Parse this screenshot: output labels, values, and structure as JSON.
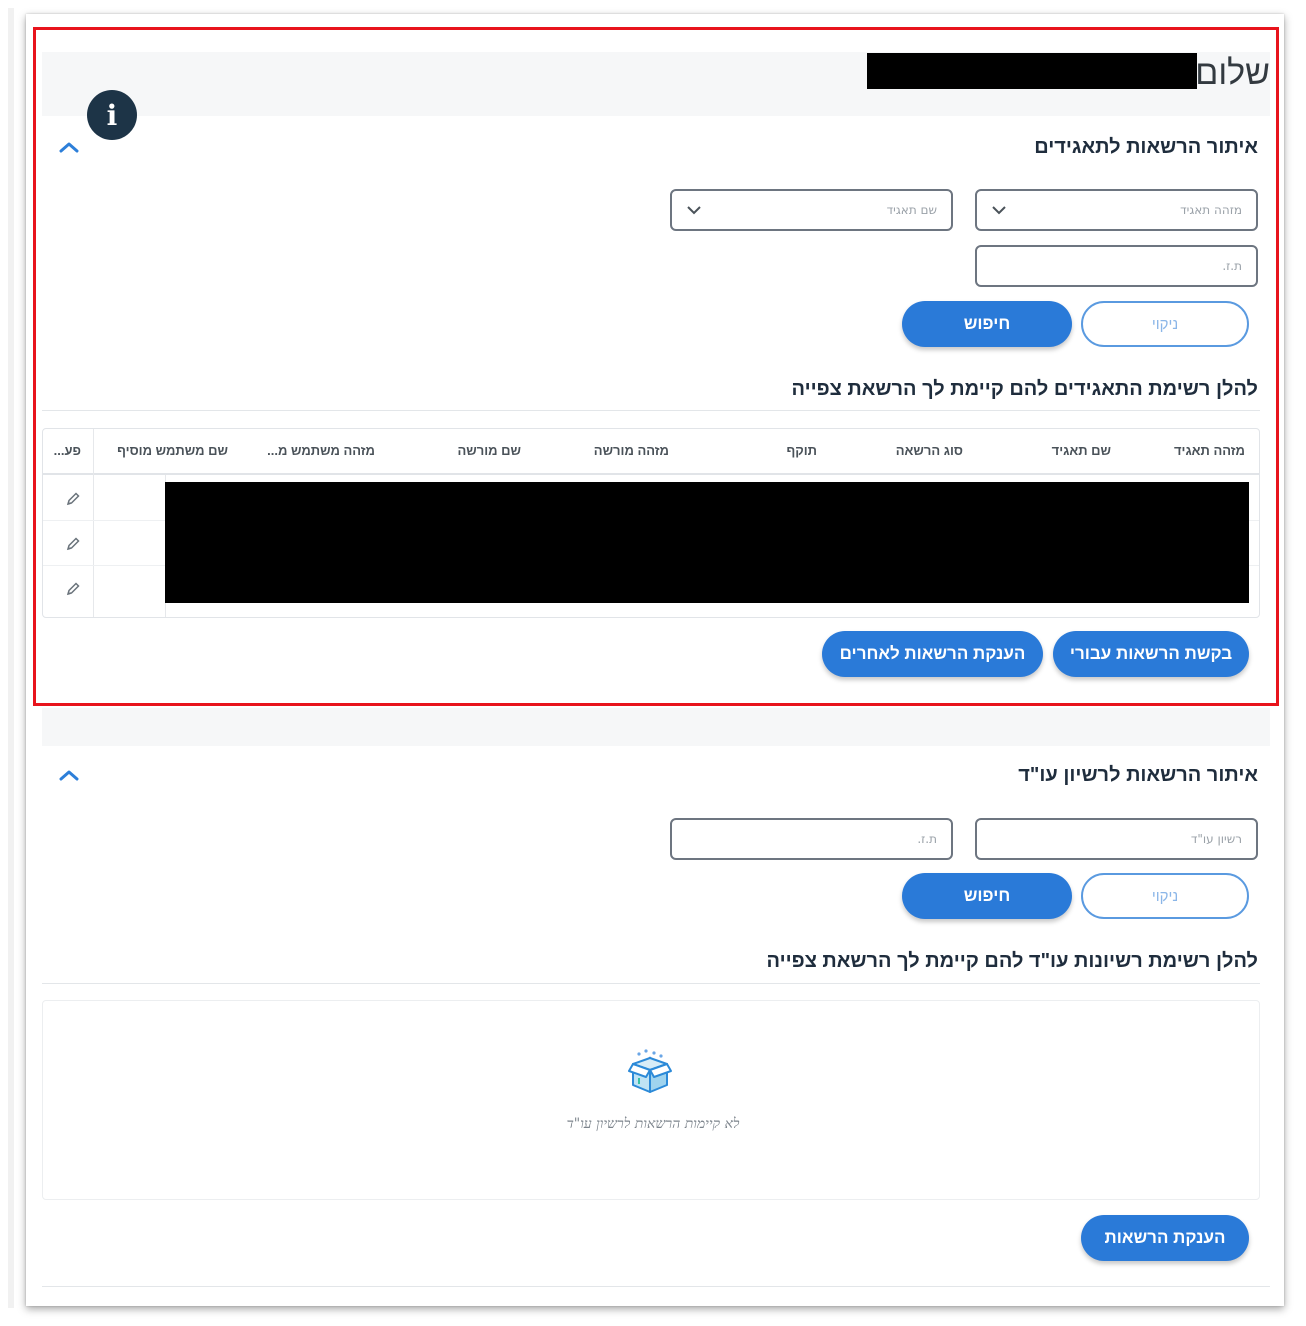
{
  "greeting": "שלום",
  "section1": {
    "title": "איתור הרשאות לתאגידים",
    "filters": {
      "corp_id_placeholder": "מזהה תאגיד",
      "corp_name_placeholder": "שם תאגיד",
      "id_placeholder": "ת.ז."
    },
    "clear_label": "ניקוי",
    "search_label": "חיפוש",
    "list_title": "להלן רשימת התאגידים להם קיימת לך הרשאת צפייה",
    "columns": [
      "מזהה תאגיד",
      "שם תאגיד",
      "סוג הרשאה",
      "תוקף",
      "מזהה מורשה",
      "שם מורשה",
      "מזהה משתמש מ...",
      "שם משתמש מוסיף",
      "פע..."
    ],
    "request_label": "בקשת הרשאות עבורי",
    "grant_label": "הענקת הרשאות לאחרים"
  },
  "section2": {
    "title": "איתור הרשאות לרשיון עו\"ד",
    "filters": {
      "license_placeholder": "רשיון עו\"ד",
      "id_placeholder": "ת.ז."
    },
    "clear_label": "ניקוי",
    "search_label": "חיפוש",
    "list_title": "להלן רשימת רשיונות עו\"ד להם קיימת לך הרשאת צפייה",
    "empty_text": "לא קיימות הרשאות לרשיון עו\"ד",
    "grant_label": "הענקת הרשאות"
  },
  "colors": {
    "primary": "#2a7ad8",
    "highlight": "#e8141c",
    "info_badge": "#1d3447"
  }
}
